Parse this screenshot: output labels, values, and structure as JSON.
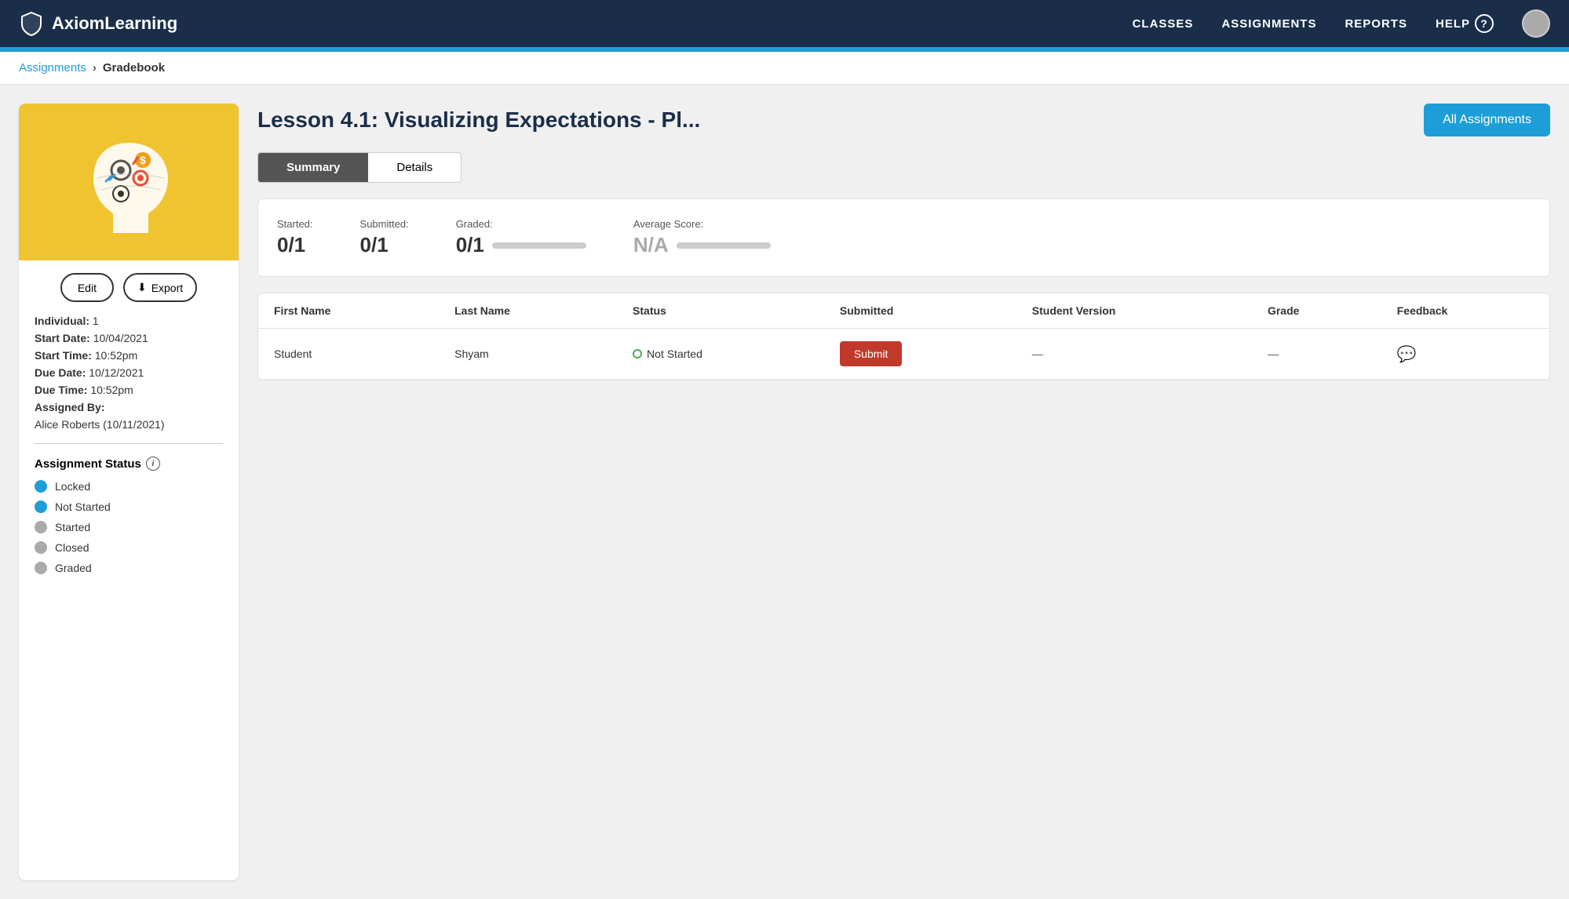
{
  "navbar": {
    "logo": "AxiomLearning",
    "links": {
      "classes": "CLASSES",
      "assignments": "ASSIGNMENTS",
      "reports": "REPORTS",
      "help": "HELP"
    }
  },
  "breadcrumb": {
    "parent": "Assignments",
    "current": "Gradebook",
    "separator": "›"
  },
  "sidebar": {
    "edit_label": "Edit",
    "export_label": "Export",
    "individual_label": "Individual:",
    "individual_value": "1",
    "start_date_label": "Start Date:",
    "start_date_value": "10/04/2021",
    "start_time_label": "Start Time:",
    "start_time_value": "10:52pm",
    "due_date_label": "Due Date:",
    "due_date_value": "10/12/2021",
    "due_time_label": "Due Time:",
    "due_time_value": "10:52pm",
    "assigned_by_label": "Assigned By:",
    "assigned_by_value": "Alice Roberts (10/11/2021)",
    "status_title": "Assignment Status",
    "statuses": [
      {
        "label": "Locked",
        "color": "locked"
      },
      {
        "label": "Not Started",
        "color": "not-started"
      },
      {
        "label": "Started",
        "color": "started"
      },
      {
        "label": "Closed",
        "color": "closed"
      },
      {
        "label": "Graded",
        "color": "graded"
      }
    ]
  },
  "content": {
    "lesson_title": "Lesson 4.1: Visualizing Expectations - Pl...",
    "all_assignments_btn": "All Assignments",
    "tabs": [
      {
        "id": "summary",
        "label": "Summary",
        "active": true
      },
      {
        "id": "details",
        "label": "Details",
        "active": false
      }
    ],
    "summary": {
      "started_label": "Started:",
      "started_value": "0/1",
      "submitted_label": "Submitted:",
      "submitted_value": "0/1",
      "graded_label": "Graded:",
      "graded_value": "0/1",
      "avg_score_label": "Average Score:",
      "avg_score_value": "N/A"
    },
    "table": {
      "headers": [
        "First Name",
        "Last Name",
        "Status",
        "Submitted",
        "Student Version",
        "Grade",
        "Feedback"
      ],
      "rows": [
        {
          "first_name": "Student",
          "last_name": "Shyam",
          "status": "Not Started",
          "submitted": "Submit",
          "student_version": "—",
          "grade": "—",
          "feedback": "💬"
        }
      ]
    }
  }
}
